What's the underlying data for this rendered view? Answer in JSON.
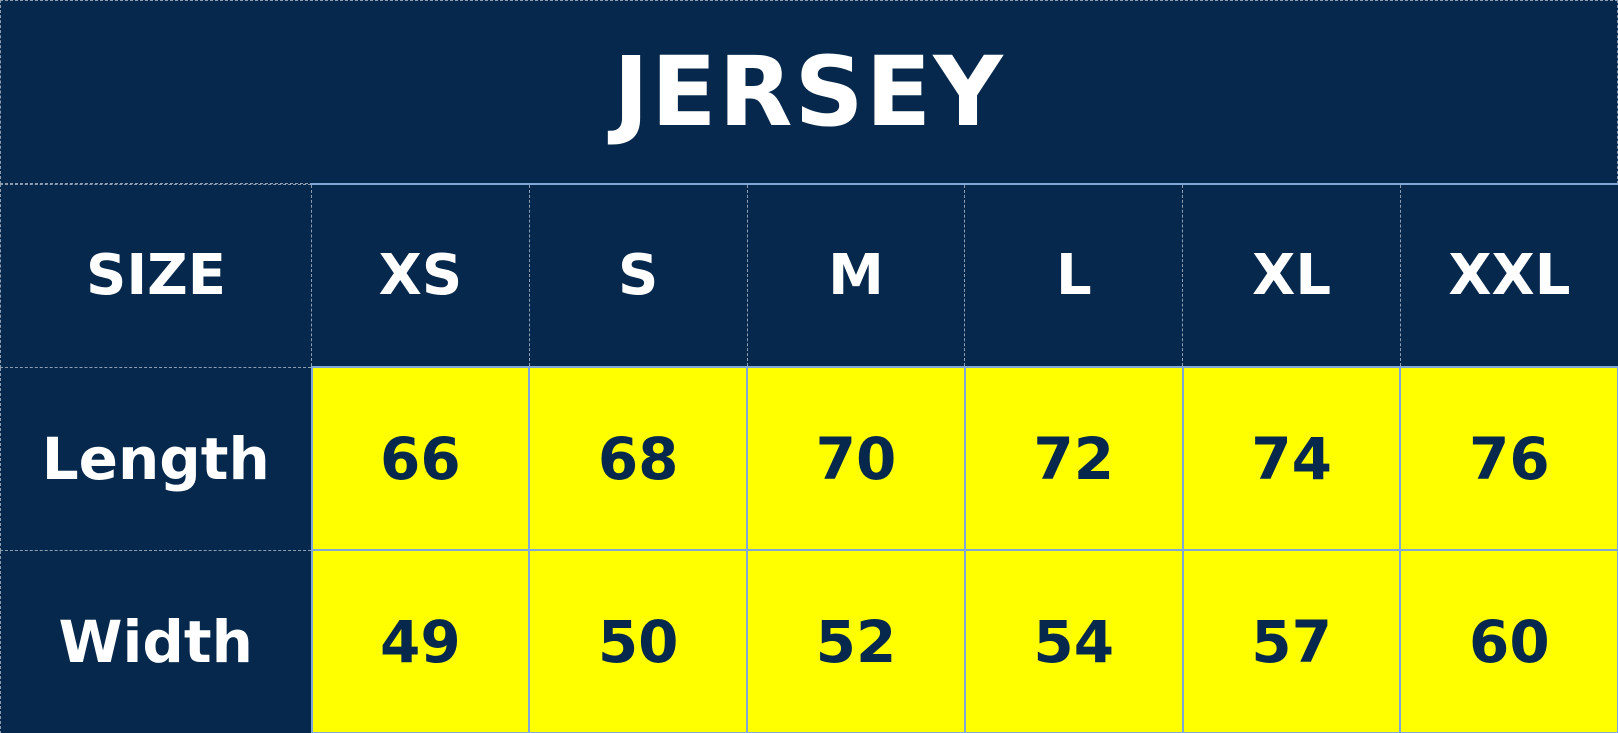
{
  "title": "JERSEY",
  "table": {
    "size_label": "SIZE",
    "sizes": [
      "XS",
      "S",
      "M",
      "L",
      "XL",
      "XXL"
    ],
    "rows": [
      {
        "label": "Length",
        "values": [
          "66",
          "68",
          "70",
          "72",
          "74",
          "76"
        ]
      },
      {
        "label": "Width",
        "values": [
          "49",
          "50",
          "52",
          "54",
          "57",
          "60"
        ]
      }
    ]
  },
  "colors": {
    "background": "#05284c",
    "value_cell": "#ffff00",
    "value_text": "#05284c",
    "header_text": "#ffffff",
    "cell_border": "#7fa7d8"
  }
}
